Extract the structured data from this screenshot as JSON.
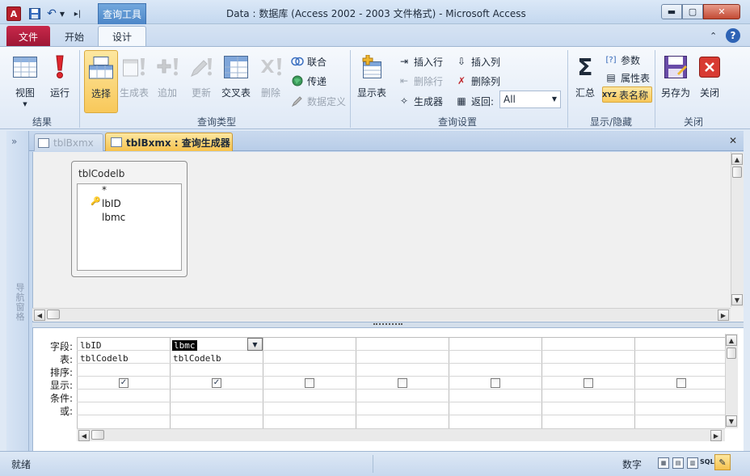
{
  "window": {
    "title": "Data : 数据库 (Access 2002 - 2003 文件格式)  -  Microsoft Access",
    "context_tab": "查询工具"
  },
  "ribbon_tabs": [
    "文件",
    "开始",
    "设计"
  ],
  "ribbon": {
    "results": {
      "label": "结果",
      "view": "视图",
      "run": "运行"
    },
    "query_type": {
      "label": "查询类型",
      "select": "选择",
      "make_table": "生成表",
      "append": "追加",
      "update": "更新",
      "crosstab": "交叉表",
      "delete": "删除",
      "union": "联合",
      "passthrough": "传递",
      "data_definition": "数据定义"
    },
    "query_setup": {
      "label": "查询设置",
      "show_table": "显示表",
      "insert_rows": "插入行",
      "delete_rows": "删除行",
      "builder": "生成器",
      "insert_columns": "插入列",
      "delete_columns": "删除列",
      "return_label": "返回:",
      "return_value": "All"
    },
    "show_hide": {
      "label": "显示/隐藏",
      "totals": "汇总",
      "parameters": "参数",
      "property_sheet": "属性表",
      "table_names": "表名称"
    },
    "close_group": {
      "label": "关闭",
      "save_as": "另存为",
      "close": "关闭"
    }
  },
  "nav_pane": {
    "label": "导航窗格"
  },
  "doc_tabs": [
    {
      "label": "tblBxmx",
      "active": false
    },
    {
      "label": "tblBxmx : 查询生成器",
      "active": true
    }
  ],
  "table_box": {
    "title": "tblCodelb",
    "fields": [
      "*",
      "lbID",
      "lbmc"
    ]
  },
  "grid": {
    "row_labels": [
      "字段:",
      "表:",
      "排序:",
      "显示:",
      "条件:",
      "或:"
    ],
    "columns": [
      {
        "field": "lbID",
        "table": "tblCodelb",
        "show": true
      },
      {
        "field": "lbmc",
        "table": "tblCodelb",
        "show": true
      },
      {
        "field": "",
        "table": "",
        "show": false
      },
      {
        "field": "",
        "table": "",
        "show": false
      },
      {
        "field": "",
        "table": "",
        "show": false
      },
      {
        "field": "",
        "table": "",
        "show": false
      },
      {
        "field": "",
        "table": "",
        "show": false
      }
    ]
  },
  "status_bar": {
    "status": "就绪",
    "num_lock": "数字",
    "sql_view_label": "SQL"
  },
  "colors": {
    "accent_yellow": "#f8c85a",
    "file_tab": "#b91f3f",
    "context_tab": "#5a92d0"
  }
}
